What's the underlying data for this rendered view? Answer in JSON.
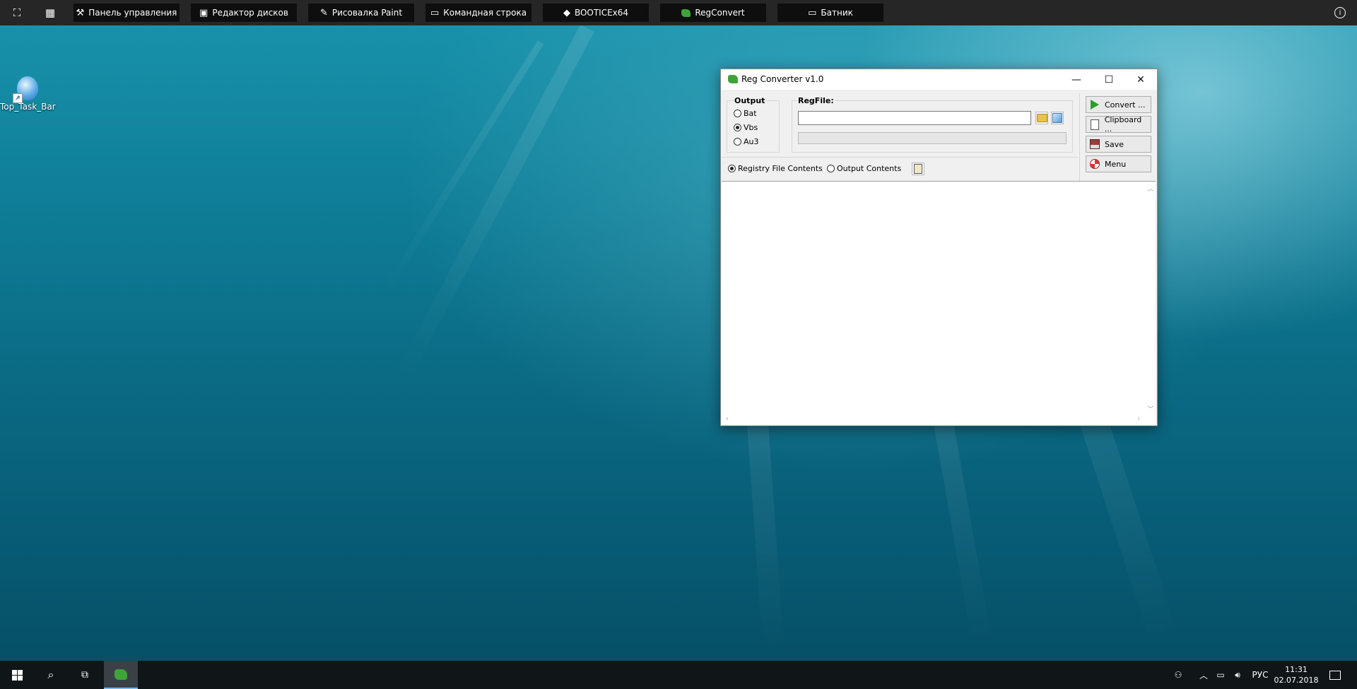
{
  "topbar": {
    "apps": [
      {
        "label": "Панель управления",
        "icon": "tools-icon"
      },
      {
        "label": "Редактор дисков",
        "icon": "disk-icon"
      },
      {
        "label": "Рисовалка Paint",
        "icon": "palette-icon"
      },
      {
        "label": "Командная строка",
        "icon": "console-icon"
      },
      {
        "label": "BOOTICEx64",
        "icon": "diamond-icon"
      },
      {
        "label": "RegConvert",
        "icon": "regconvert-icon"
      },
      {
        "label": "Батник",
        "icon": "window-icon"
      }
    ],
    "info_icon": "info-icon"
  },
  "desktop": {
    "icons": [
      {
        "label": "Top_Task_Bar"
      }
    ]
  },
  "window": {
    "title": "Reg Converter v1.0",
    "output_label": "Output",
    "output_options": [
      "Bat",
      "Vbs",
      "Au3"
    ],
    "output_selected": "Vbs",
    "regfile_label": "RegFile:",
    "regfile_value": "",
    "view_options": [
      "Registry File Contents",
      "Output Contents"
    ],
    "view_selected": "Registry File Contents",
    "buttons": {
      "convert": "Convert ...",
      "clipboard": "Clipboard ...",
      "save": "Save",
      "menu": "Menu"
    },
    "editor_text": ""
  },
  "taskbar": {
    "language": "РУС",
    "time": "11:31",
    "date": "02.07.2018"
  },
  "colors": {
    "accent_green": "#3fa33a",
    "taskbar": "#101518",
    "topbar": "#262626"
  }
}
